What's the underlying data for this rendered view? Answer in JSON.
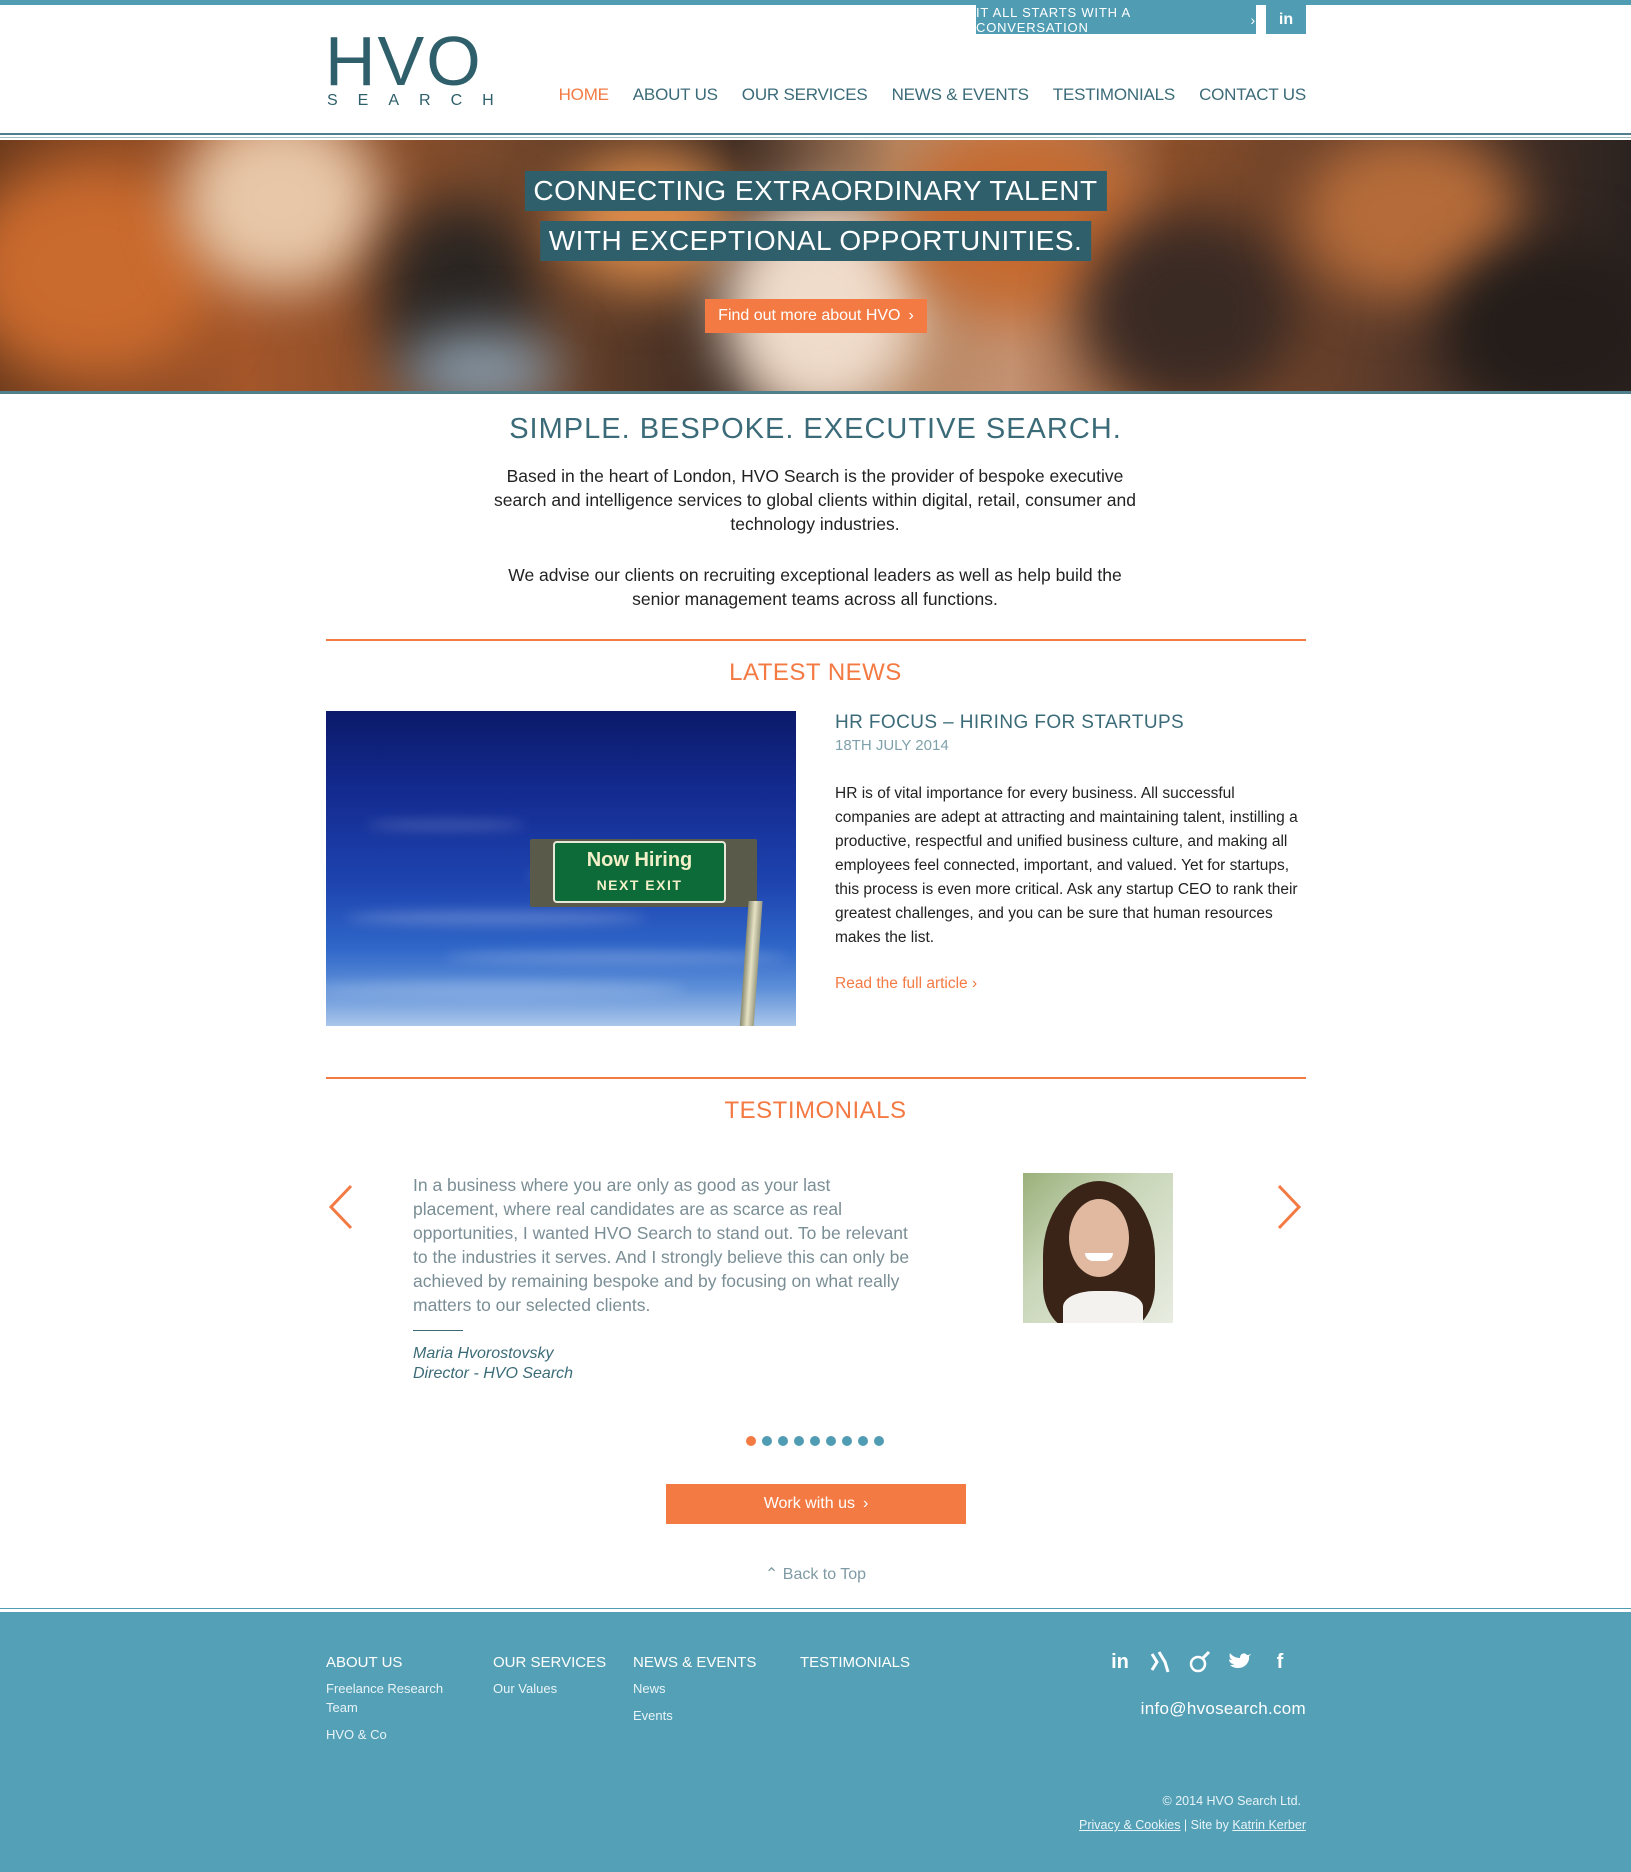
{
  "header": {
    "cta_label": "IT ALL STARTS WITH A CONVERSATION",
    "linkedin_label": "in",
    "logo_big": "HVO",
    "logo_small": "SEARCH",
    "nav": [
      {
        "label": "HOME",
        "active": true
      },
      {
        "label": "ABOUT US"
      },
      {
        "label": "OUR SERVICES"
      },
      {
        "label": "NEWS & EVENTS"
      },
      {
        "label": "TESTIMONIALS"
      },
      {
        "label": "CONTACT US"
      }
    ]
  },
  "hero": {
    "line1": "CONNECTING EXTRAORDINARY TALENT",
    "line2": "WITH EXCEPTIONAL OPPORTUNITIES.",
    "button_label": "Find out more about HVO"
  },
  "intro": {
    "title": "SIMPLE. BESPOKE. EXECUTIVE SEARCH.",
    "paragraph1": "Based in the heart of London, HVO Search is the provider of bespoke executive search and intelligence services to global clients within digital, retail, consumer and technology industries.",
    "paragraph2": "We advise our clients on recruiting exceptional leaders as well as help build the senior management teams across all functions."
  },
  "news": {
    "section_title": "LATEST NEWS",
    "image_sign_line1": "Now Hiring",
    "image_sign_line2": "NEXT EXIT",
    "title": "HR FOCUS – HIRING FOR STARTUPS",
    "date": "18TH JULY 2014",
    "body": "HR is of vital importance for every business. All successful companies are adept at attracting and maintaining talent, instilling a productive, respectful and unified business culture, and making all employees feel connected, important, and valued. Yet for startups, this process is even more critical. Ask any startup CEO to rank their greatest challenges, and you can be sure that human resources makes the list.",
    "link_label": "Read the full article"
  },
  "testimonials": {
    "section_title": "TESTIMONIALS",
    "quote": "In a business where you are only as good as your last placement, where real candidates are as scarce as real opportunities, I wanted HVO Search to stand out. To be relevant to the industries it serves. And I strongly believe this can only be achieved by remaining bespoke and by focusing on what really matters to our selected clients.",
    "name": "Maria Hvorostovsky",
    "role": "Director - HVO Search",
    "dots_total": 9,
    "dots_active_index": 0,
    "work_button_label": "Work with us",
    "back_to_top_label": "Back to Top"
  },
  "footer": {
    "columns": [
      {
        "head": "ABOUT US",
        "items": [
          "Freelance Research Team",
          "HVO & Co"
        ]
      },
      {
        "head": "OUR SERVICES",
        "items": [
          "Our Values"
        ]
      },
      {
        "head": "NEWS & EVENTS",
        "items": [
          "News",
          "Events"
        ]
      },
      {
        "head": "TESTIMONIALS",
        "items": []
      }
    ],
    "social_icons": [
      "linkedin-icon",
      "xing-icon",
      "viadeo-icon",
      "twitter-icon",
      "facebook-icon"
    ],
    "email": "info@hvosearch.com",
    "copyright": "© 2014 HVO Search Ltd.",
    "privacy_label": "Privacy & Cookies",
    "site_by_label": " | Site by ",
    "designer_label": "Katrin Kerber"
  },
  "colors": {
    "accent": "#f37a43",
    "teal": "#4f9cb3",
    "dark_teal": "#2f5f6b",
    "footer_bg": "#54a0b6"
  }
}
